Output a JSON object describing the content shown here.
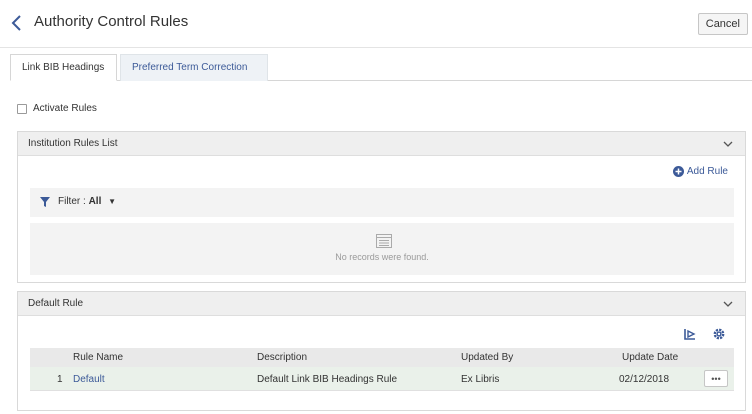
{
  "header": {
    "title": "Authority Control Rules",
    "cancel_label": "Cancel"
  },
  "tabs": [
    {
      "label": "Link BIB Headings",
      "active": true
    },
    {
      "label": "Preferred Term Correction",
      "active": false
    }
  ],
  "activate": {
    "label": "Activate Rules",
    "checked": false
  },
  "rules_list": {
    "title": "Institution Rules List",
    "add_label": "Add Rule",
    "filter_label": "Filter :",
    "filter_value": "All",
    "empty_text": "No records were found."
  },
  "default_rule": {
    "title": "Default Rule",
    "columns": [
      "Rule Name",
      "Description",
      "Updated By",
      "Update Date"
    ],
    "rows": [
      {
        "index": "1",
        "name": "Default",
        "description": "Default Link BIB Headings Rule",
        "updated_by": "Ex Libris",
        "date": "02/12/2018",
        "actions": "•••"
      }
    ]
  },
  "colors": {
    "link": "#3c5a98",
    "header_bg": "#efefef",
    "selected_row": "#eaf1ea"
  },
  "icons": [
    "chevron-left-icon",
    "chevron-down-icon",
    "plus-circle-icon",
    "filter-icon",
    "list-empty-icon",
    "export-icon",
    "gear-icon",
    "more-icon"
  ]
}
